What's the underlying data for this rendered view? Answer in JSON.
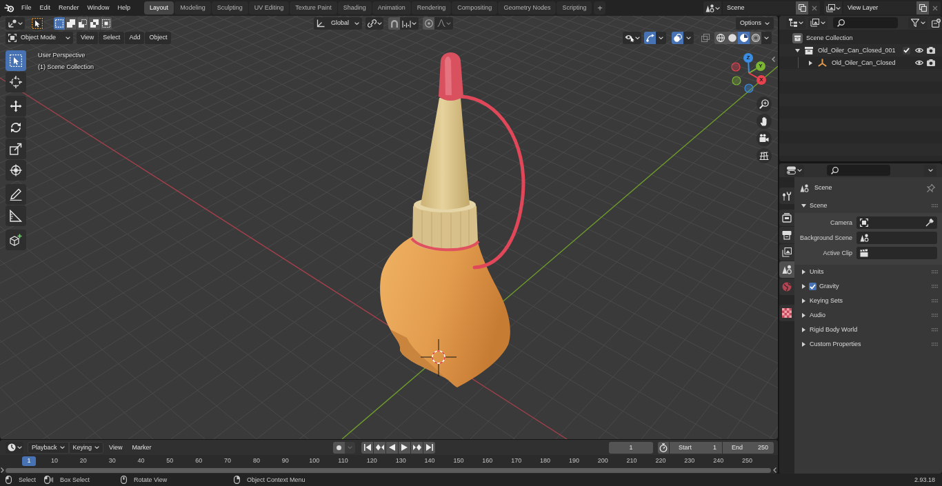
{
  "top_bar": {
    "menus": [
      "File",
      "Edit",
      "Render",
      "Window",
      "Help"
    ],
    "workspaces": [
      {
        "label": "Layout",
        "selected": true
      },
      {
        "label": "Modeling",
        "selected": false
      },
      {
        "label": "Sculpting",
        "selected": false
      },
      {
        "label": "UV Editing",
        "selected": false
      },
      {
        "label": "Texture Paint",
        "selected": false
      },
      {
        "label": "Shading",
        "selected": false
      },
      {
        "label": "Animation",
        "selected": false
      },
      {
        "label": "Rendering",
        "selected": false
      },
      {
        "label": "Compositing",
        "selected": false
      },
      {
        "label": "Geometry Nodes",
        "selected": false
      },
      {
        "label": "Scripting",
        "selected": false
      }
    ],
    "add_workspace": "+",
    "scene": "Scene",
    "view_layer": "View Layer"
  },
  "tool_header": {
    "select_modes": [
      {
        "kind": "set",
        "selected": true
      },
      {
        "kind": "extend",
        "selected": false
      },
      {
        "kind": "subtract",
        "selected": false
      },
      {
        "kind": "difference",
        "selected": false
      },
      {
        "kind": "intersect",
        "selected": false
      }
    ],
    "orientation": "Global",
    "options": "Options"
  },
  "viewport_header": {
    "mode": "Object Mode",
    "menus": [
      "View",
      "Select",
      "Add",
      "Object"
    ],
    "gizmos_on": true,
    "overlays_on": true,
    "xray_on": false,
    "shading": [
      {
        "kind": "wireframe",
        "selected": false
      },
      {
        "kind": "solid",
        "selected": false
      },
      {
        "kind": "material",
        "selected": true
      },
      {
        "kind": "rendered",
        "selected": false
      }
    ]
  },
  "toolbar": {
    "groups": [
      {
        "tools": [
          {
            "kind": "select_box",
            "selected": true
          },
          {
            "kind": "cursor",
            "selected": false
          }
        ]
      },
      {
        "tools": [
          {
            "kind": "move",
            "selected": false
          },
          {
            "kind": "rotate",
            "selected": false
          },
          {
            "kind": "scale",
            "selected": false
          },
          {
            "kind": "transform",
            "selected": false
          }
        ]
      },
      {
        "tools": [
          {
            "kind": "annotate",
            "selected": false
          },
          {
            "kind": "measure",
            "selected": false
          }
        ]
      },
      {
        "tools": [
          {
            "kind": "add_cube",
            "selected": false
          }
        ]
      }
    ]
  },
  "viewport": {
    "view_name": "User Perspective",
    "collection": "(1) Scene Collection",
    "gizmo_axes": [
      {
        "label": "Z",
        "color": "#3a8ee6"
      },
      {
        "label": "Y",
        "color": "#7ab534"
      },
      {
        "label": "X",
        "color": "#e8424f"
      }
    ]
  },
  "outliner": {
    "root": "Scene Collection",
    "tree": [
      {
        "name": "Old_Oiler_Can_Closed_001",
        "kind": "collection",
        "expanded": true,
        "checkbox": {
          "checked": true
        },
        "children": [
          {
            "name": "Old_Oiler_Can_Closed",
            "kind": "empty",
            "expanded": false
          }
        ]
      }
    ]
  },
  "properties": {
    "tab_groups": [
      {
        "tabs": [
          {
            "kind": "tool",
            "selected": false
          }
        ]
      },
      {
        "tabs": [
          {
            "kind": "render",
            "selected": false
          },
          {
            "kind": "output",
            "selected": false
          },
          {
            "kind": "view_layer",
            "selected": false
          },
          {
            "kind": "scene",
            "selected": true
          },
          {
            "kind": "world",
            "selected": false
          }
        ]
      },
      {
        "tabs": [
          {
            "kind": "texture",
            "selected": false
          }
        ]
      }
    ],
    "context": "Scene",
    "panels": [
      {
        "title": "Scene",
        "expanded": true,
        "fields": [
          {
            "label": "Camera",
            "kind": "camera"
          },
          {
            "label": "Background Scene",
            "kind": "scene"
          },
          {
            "label": "Active Clip",
            "kind": "clip"
          }
        ]
      },
      {
        "title": "Units",
        "expanded": false
      },
      {
        "title": "Gravity",
        "expanded": false,
        "checkbox": {
          "checked": true
        }
      },
      {
        "title": "Keying Sets",
        "expanded": false
      },
      {
        "title": "Audio",
        "expanded": false
      },
      {
        "title": "Rigid Body World",
        "expanded": false
      },
      {
        "title": "Custom Properties",
        "expanded": false
      }
    ]
  },
  "timeline": {
    "menus": [
      {
        "label": "Playback",
        "kind": "dropdown"
      },
      {
        "label": "Keying",
        "kind": "dropdown"
      },
      {
        "label": "View",
        "kind": "menu"
      },
      {
        "label": "Marker",
        "kind": "menu"
      }
    ],
    "auto_keying": false,
    "current_frame": "1",
    "start": {
      "label": "Start",
      "value": "1"
    },
    "end": {
      "label": "End",
      "value": "250"
    },
    "ruler": [
      {
        "label": "1",
        "selected": true
      },
      {
        "label": "10",
        "selected": false
      },
      {
        "label": "20",
        "selected": false
      },
      {
        "label": "30",
        "selected": false
      },
      {
        "label": "40",
        "selected": false
      },
      {
        "label": "50",
        "selected": false
      },
      {
        "label": "60",
        "selected": false
      },
      {
        "label": "70",
        "selected": false
      },
      {
        "label": "80",
        "selected": false
      },
      {
        "label": "90",
        "selected": false
      },
      {
        "label": "100",
        "selected": false
      },
      {
        "label": "110",
        "selected": false
      },
      {
        "label": "120",
        "selected": false
      },
      {
        "label": "130",
        "selected": false
      },
      {
        "label": "140",
        "selected": false
      },
      {
        "label": "150",
        "selected": false
      },
      {
        "label": "160",
        "selected": false
      },
      {
        "label": "170",
        "selected": false
      },
      {
        "label": "180",
        "selected": false
      },
      {
        "label": "190",
        "selected": false
      },
      {
        "label": "200",
        "selected": false
      },
      {
        "label": "210",
        "selected": false
      },
      {
        "label": "220",
        "selected": false
      },
      {
        "label": "230",
        "selected": false
      },
      {
        "label": "240",
        "selected": false
      },
      {
        "label": "250",
        "selected": false
      }
    ]
  },
  "status_bar": {
    "hints": [
      {
        "label": "Select",
        "kind": "left_click"
      },
      {
        "label": "Box Select",
        "kind": "left_drag"
      },
      {
        "label": "Rotate View",
        "kind": "middle_drag"
      },
      {
        "label": "Object Context Menu",
        "kind": "right_click"
      }
    ],
    "version": "2.93.18"
  }
}
